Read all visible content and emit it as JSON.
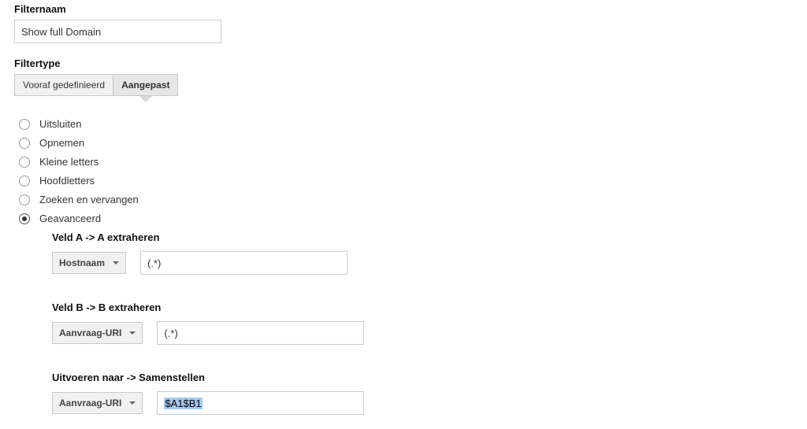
{
  "filterName": {
    "label": "Filternaam",
    "value": "Show full Domain"
  },
  "filterType": {
    "label": "Filtertype",
    "tabs": {
      "predefined": "Vooraf gedefinieerd",
      "custom": "Aangepast"
    }
  },
  "radioOptions": {
    "exclude": "Uitsluiten",
    "include": "Opnemen",
    "lowercase": "Kleine letters",
    "uppercase": "Hoofdletters",
    "searchReplace": "Zoeken en vervangen",
    "advanced": "Geavanceerd"
  },
  "advanced": {
    "fieldA": {
      "label": "Veld A -> A extraheren",
      "dropdown": "Hostnaam",
      "pattern": "(.*)"
    },
    "fieldB": {
      "label": "Veld B -> B extraheren",
      "dropdown": "Aanvraag-URI",
      "pattern": "(.*)"
    },
    "output": {
      "label": "Uitvoeren naar -> Samenstellen",
      "dropdown": "Aanvraag-URI",
      "pattern": "$A1$B1"
    }
  }
}
